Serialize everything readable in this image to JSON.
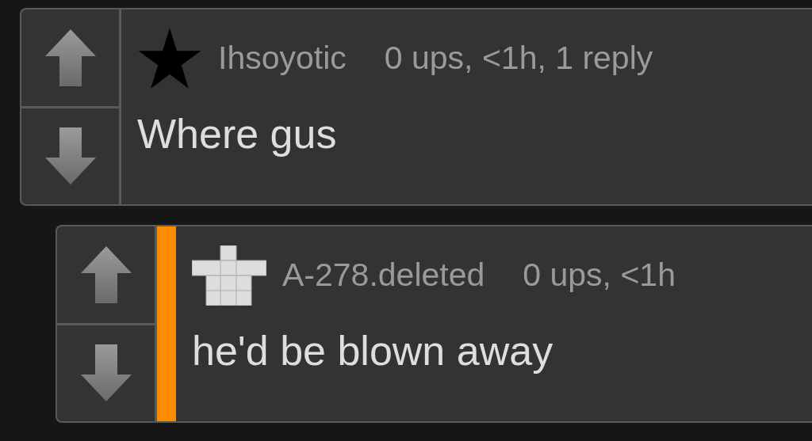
{
  "comments": [
    {
      "kind": "top",
      "username": "Ihsoyotic",
      "meta": "0 ups, <1h, 1 reply",
      "body": "Where gus"
    },
    {
      "kind": "reply",
      "username": "A-278.deleted",
      "meta": "0 ups, <1h",
      "body": "he'd be blown away"
    }
  ]
}
